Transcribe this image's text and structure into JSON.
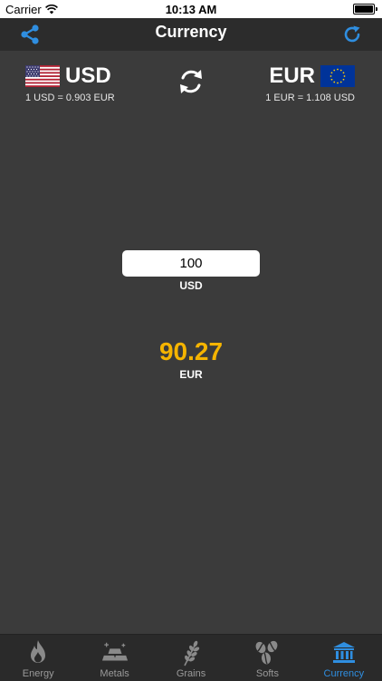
{
  "status_bar": {
    "carrier": "Carrier",
    "time": "10:13 AM"
  },
  "nav": {
    "title": "Currency"
  },
  "from_currency": {
    "code": "USD",
    "rate": "1 USD = 0.903 EUR"
  },
  "to_currency": {
    "code": "EUR",
    "rate": "1 EUR = 1.108 USD"
  },
  "converter": {
    "input_value": "100",
    "input_code": "USD",
    "result_value": "90.27",
    "result_code": "EUR"
  },
  "tabs": [
    {
      "label": "Energy",
      "icon": "flame-icon"
    },
    {
      "label": "Metals",
      "icon": "gold-bars-icon"
    },
    {
      "label": "Grains",
      "icon": "wheat-icon"
    },
    {
      "label": "Softs",
      "icon": "coffee-beans-icon"
    },
    {
      "label": "Currency",
      "icon": "bank-icon",
      "active": true
    }
  ],
  "colors": {
    "accent": "#2f8ee0",
    "result": "#f5b400",
    "background": "#3b3b3b",
    "bar": "#2c2c2c"
  }
}
